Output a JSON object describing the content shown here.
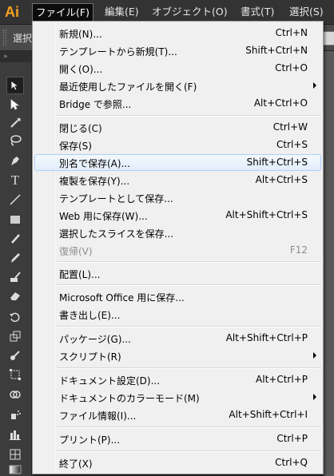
{
  "app": {
    "logo": "Ai"
  },
  "menubar": [
    {
      "label": "ファイル(F)",
      "active": true
    },
    {
      "label": "編集(E)"
    },
    {
      "label": "オブジェクト(O)"
    },
    {
      "label": "書式(T)"
    },
    {
      "label": "選択(S)"
    }
  ],
  "controlbar": {
    "label": "選択"
  },
  "toolbar": {
    "tools": [
      "selection-tool",
      "direct-selection-tool",
      "magic-wand-tool",
      "lasso-tool",
      "pen-tool",
      "type-tool",
      "line-tool",
      "rectangle-tool",
      "paintbrush-tool",
      "pencil-tool",
      "blob-brush-tool",
      "eraser-tool",
      "rotate-tool",
      "scale-tool",
      "warp-tool",
      "free-transform-tool",
      "shape-builder-tool",
      "symbol-sprayer-tool",
      "column-graph-tool",
      "mesh-tool",
      "gradient-tool",
      "eyedropper-tool"
    ]
  },
  "file_menu": {
    "items": [
      {
        "label": "新規(N)...",
        "shortcut": "Ctrl+N"
      },
      {
        "label": "テンプレートから新規(T)...",
        "shortcut": "Shift+Ctrl+N"
      },
      {
        "label": "開く(O)...",
        "shortcut": "Ctrl+O"
      },
      {
        "label": "最近使用したファイルを開く(F)",
        "shortcut": "",
        "submenu": true
      },
      {
        "label": "Bridge で参照...",
        "shortcut": "Alt+Ctrl+O"
      },
      {
        "label": "閉じる(C)",
        "shortcut": "Ctrl+W"
      },
      {
        "label": "保存(S)",
        "shortcut": "Ctrl+S"
      },
      {
        "label": "別名で保存(A)...",
        "shortcut": "Shift+Ctrl+S",
        "highlighted": true
      },
      {
        "label": "複製を保存(Y)...",
        "shortcut": "Alt+Ctrl+S"
      },
      {
        "label": "テンプレートとして保存...",
        "shortcut": ""
      },
      {
        "label": "Web 用に保存(W)...",
        "shortcut": "Alt+Shift+Ctrl+S"
      },
      {
        "label": "選択したスライスを保存...",
        "shortcut": ""
      },
      {
        "label": "復帰(V)",
        "shortcut": "F12",
        "disabled": true
      },
      {
        "label": "配置(L)...",
        "shortcut": ""
      },
      {
        "label": "Microsoft Office 用に保存...",
        "shortcut": ""
      },
      {
        "label": "書き出し(E)...",
        "shortcut": ""
      },
      {
        "label": "パッケージ(G)...",
        "shortcut": "Alt+Shift+Ctrl+P"
      },
      {
        "label": "スクリプト(R)",
        "shortcut": "",
        "submenu": true
      },
      {
        "label": "ドキュメント設定(D)...",
        "shortcut": "Alt+Ctrl+P"
      },
      {
        "label": "ドキュメントのカラーモード(M)",
        "shortcut": "",
        "submenu": true
      },
      {
        "label": "ファイル情報(I)...",
        "shortcut": "Alt+Shift+Ctrl+I"
      },
      {
        "label": "プリント(P)...",
        "shortcut": "Ctrl+P"
      },
      {
        "label": "終了(X)",
        "shortcut": "Ctrl+Q"
      }
    ]
  }
}
